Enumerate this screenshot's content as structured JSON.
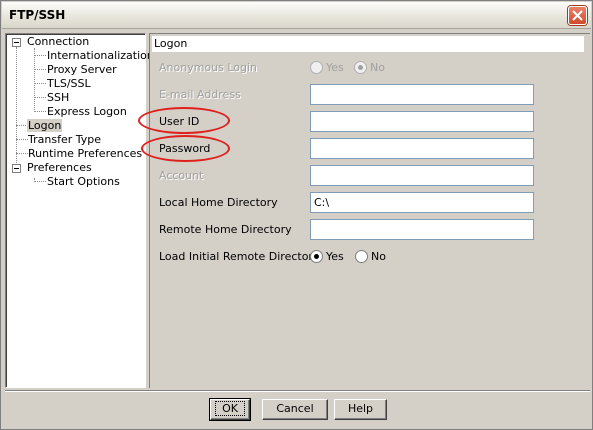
{
  "window": {
    "title": "FTP/SSH"
  },
  "tree": {
    "items": [
      {
        "label": "Connection",
        "level": 0,
        "expandable": true
      },
      {
        "label": "Internationalization",
        "level": 1
      },
      {
        "label": "Proxy Server",
        "level": 1
      },
      {
        "label": "TLS/SSL",
        "level": 1
      },
      {
        "label": "SSH",
        "level": 1
      },
      {
        "label": "Express Logon",
        "level": 1
      },
      {
        "label": "Logon",
        "level": 0,
        "selected": true
      },
      {
        "label": "Transfer Type",
        "level": 0
      },
      {
        "label": "Runtime Preferences",
        "level": 0
      },
      {
        "label": "Preferences",
        "level": 0,
        "expandable": true
      },
      {
        "label": "Start Options",
        "level": 1
      }
    ]
  },
  "panel": {
    "header": "Logon",
    "anonymous_login": {
      "label": "Anonymous Login",
      "options": [
        "Yes",
        "No"
      ],
      "selected": "No",
      "enabled": false
    },
    "email": {
      "label": "E-mail Address",
      "value": "",
      "enabled": false
    },
    "user_id": {
      "label": "User ID",
      "value": ""
    },
    "password": {
      "label": "Password",
      "value": ""
    },
    "account": {
      "label": "Account",
      "value": "",
      "enabled": false
    },
    "local_home": {
      "label": "Local Home Directory",
      "value": "C:\\"
    },
    "remote_home": {
      "label": "Remote Home Directory",
      "value": ""
    },
    "load_initial": {
      "label": "Load Initial Remote Directory",
      "options": [
        "Yes",
        "No"
      ],
      "selected": "Yes"
    }
  },
  "annotations": {
    "highlight_color": "#e0201c"
  },
  "buttons": {
    "ok": "OK",
    "cancel": "Cancel",
    "help": "Help"
  }
}
